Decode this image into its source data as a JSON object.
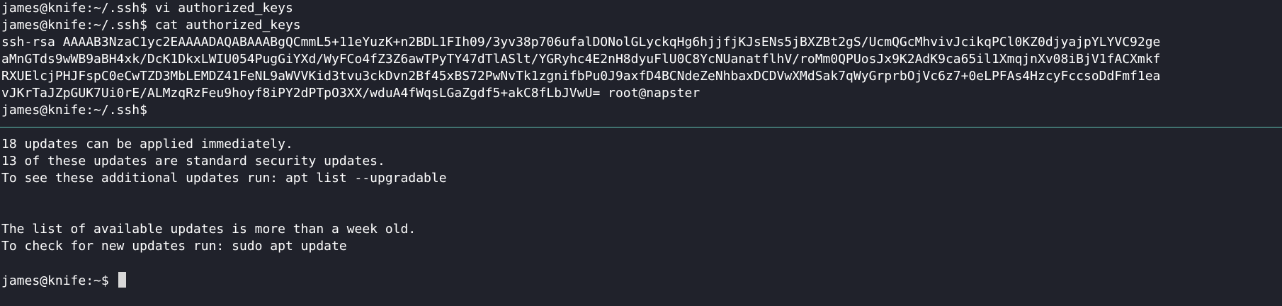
{
  "colors": {
    "background": "#20222b",
    "text": "#ffffff",
    "divider": "#5fc2b2",
    "cursor": "#d8d8d8"
  },
  "session_top": {
    "lines": [
      "james@knife:~/.ssh$ vi authorized_keys",
      "james@knife:~/.ssh$ cat authorized_keys",
      "ssh-rsa AAAAB3NzaC1yc2EAAAADAQABAAABgQCmmL5+11eYuzK+n2BDL1FIh09/3yv38p706ufalDONolGLyckqHg6hjjfjKJsENs5jBXZBt2gS/UcmQGcMhvivJcikqPCl0KZ0djyajpYLYVC92ge",
      "aMnGTds9wWB9aBH4xk/DcK1DkxLWIU054PugGiYXd/WyFCo4fZ3Z6awTPyTY47dTlASlt/YGRyhc4E2nH8dyuFlU0C8YcNUanatflhV/roMm0QPUosJx9K2AdK9ca65il1XmqjnXv08iBjV1fACXmkf",
      "RXUElcjPHJFspC0eCwTZD3MbLEMDZ41FeNL9aWVVKid3tvu3ckDvn2Bf45xBS72PwNvTk1zgnifbPu0J9axfD4BCNdeZeNhbaxDCDVwXMdSak7qWyGrprbOjVc6z7+0eLPFAs4HzcyFccsoDdFmf1ea",
      "vJKrTaJZpGUK7Ui0rE/ALMzqRzFeu9hoyf8iPY2dPTpO3XX/wduA4fWqsLGaZgdf5+akC8fLbJVwU= root@napster",
      "james@knife:~/.ssh$"
    ]
  },
  "session_bottom": {
    "lines": [
      "18 updates can be applied immediately.",
      "13 of these updates are standard security updates.",
      "To see these additional updates run: apt list --upgradable",
      "",
      "",
      "The list of available updates is more than a week old.",
      "To check for new updates run: sudo apt update",
      ""
    ],
    "prompt": "james@knife:~$ "
  }
}
